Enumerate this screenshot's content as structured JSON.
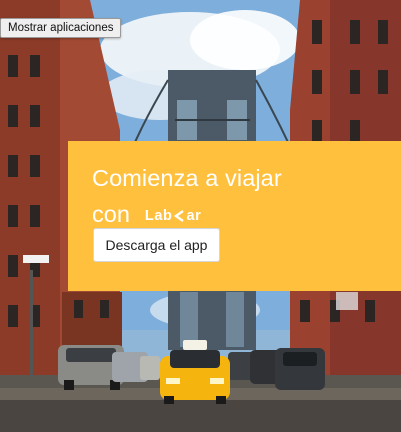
{
  "tooltip": {
    "label": "Mostrar aplicaciones"
  },
  "promo": {
    "title": "Comienza a viajar",
    "con": "con",
    "brand": {
      "left": "Lab",
      "right": "ar",
      "icon": "chevron-left-icon"
    },
    "button_label": "Descarga el app",
    "bg_color": "#ffc03e"
  },
  "scene": {
    "icons": [
      "brick-building-icon",
      "bridge-tower-icon",
      "taxi-icon",
      "car-icon"
    ],
    "colors": {
      "sky": "#8fb6d6",
      "brick": "#a24a33",
      "taxi": "#f6b40f",
      "road": "#5a5650"
    }
  }
}
